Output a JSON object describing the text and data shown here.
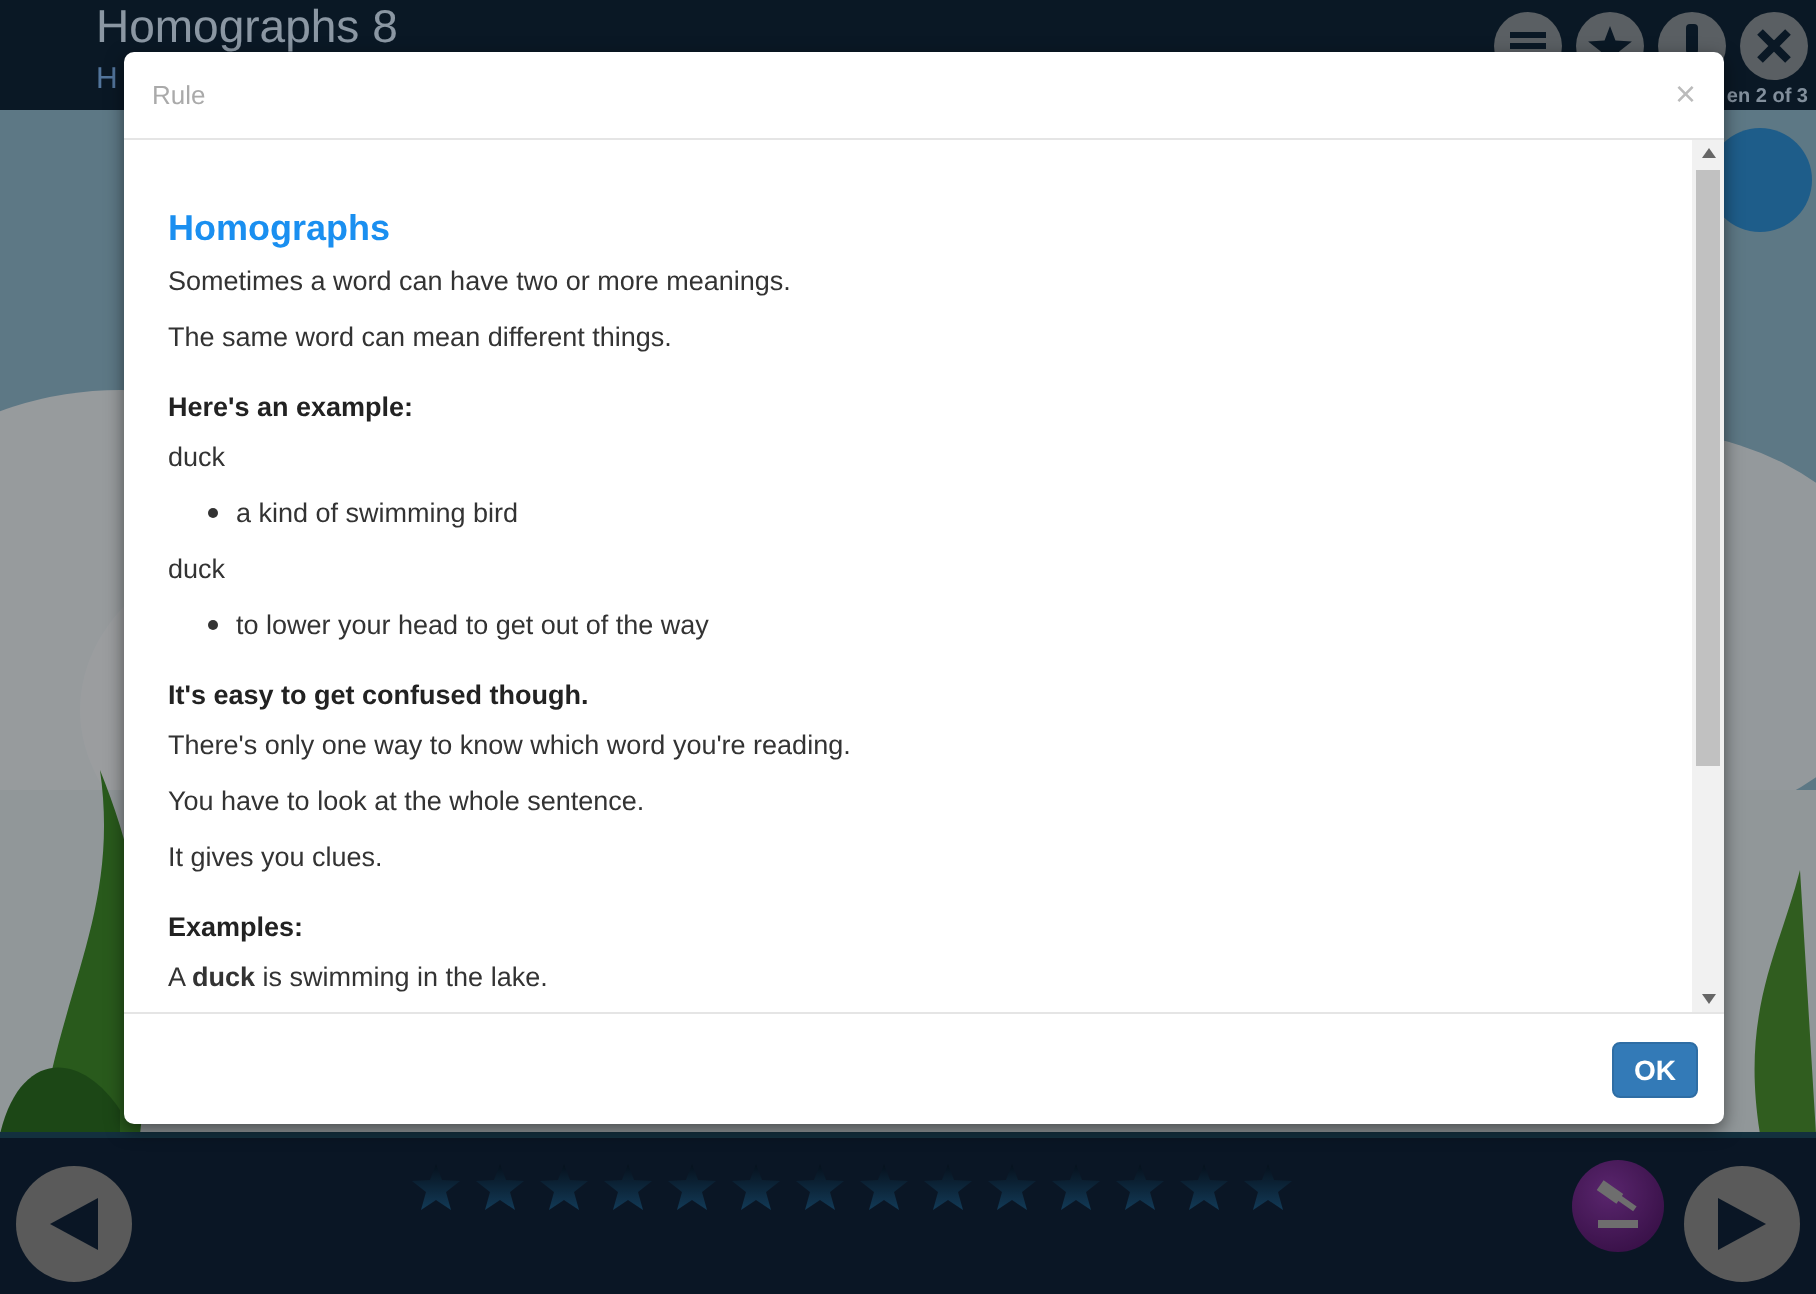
{
  "header": {
    "title": "Homographs 8",
    "subtitle": "H",
    "screen_counter": "en 2 of 3"
  },
  "dialog": {
    "title": "Rule",
    "close": "×",
    "ok": "OK",
    "content": [
      {
        "kind": "heading",
        "text": "Homographs"
      },
      {
        "kind": "paragraph",
        "text": "Sometimes a word can have two or more meanings."
      },
      {
        "kind": "paragraph",
        "text": "The same word can mean different things."
      },
      {
        "kind": "subheading",
        "text": "Here's an example:"
      },
      {
        "kind": "paragraph",
        "text": "duck"
      },
      {
        "kind": "bullet",
        "text": "a kind of swimming bird"
      },
      {
        "kind": "paragraph",
        "text": "duck"
      },
      {
        "kind": "bullet",
        "text": "to lower your head to get out of the way"
      },
      {
        "kind": "subheading",
        "text": "It's easy to get confused though."
      },
      {
        "kind": "paragraph",
        "text": "There's only one way to know which word you're reading."
      },
      {
        "kind": "paragraph",
        "text": "You have to look at the whole sentence."
      },
      {
        "kind": "paragraph",
        "text": "It gives you clues."
      },
      {
        "kind": "subheading",
        "text": "Examples:"
      },
      {
        "kind": "paragraph",
        "text": "A **duck** is swimming in the lake."
      }
    ]
  },
  "progress": [
    {
      "filled": false
    },
    {
      "filled": false
    },
    {
      "filled": false
    },
    {
      "filled": false
    },
    {
      "filled": false
    },
    {
      "filled": false
    },
    {
      "filled": false
    },
    {
      "filled": false
    },
    {
      "filled": false
    },
    {
      "filled": false
    },
    {
      "filled": false
    },
    {
      "filled": false
    },
    {
      "filled": false
    },
    {
      "filled": false
    }
  ]
}
